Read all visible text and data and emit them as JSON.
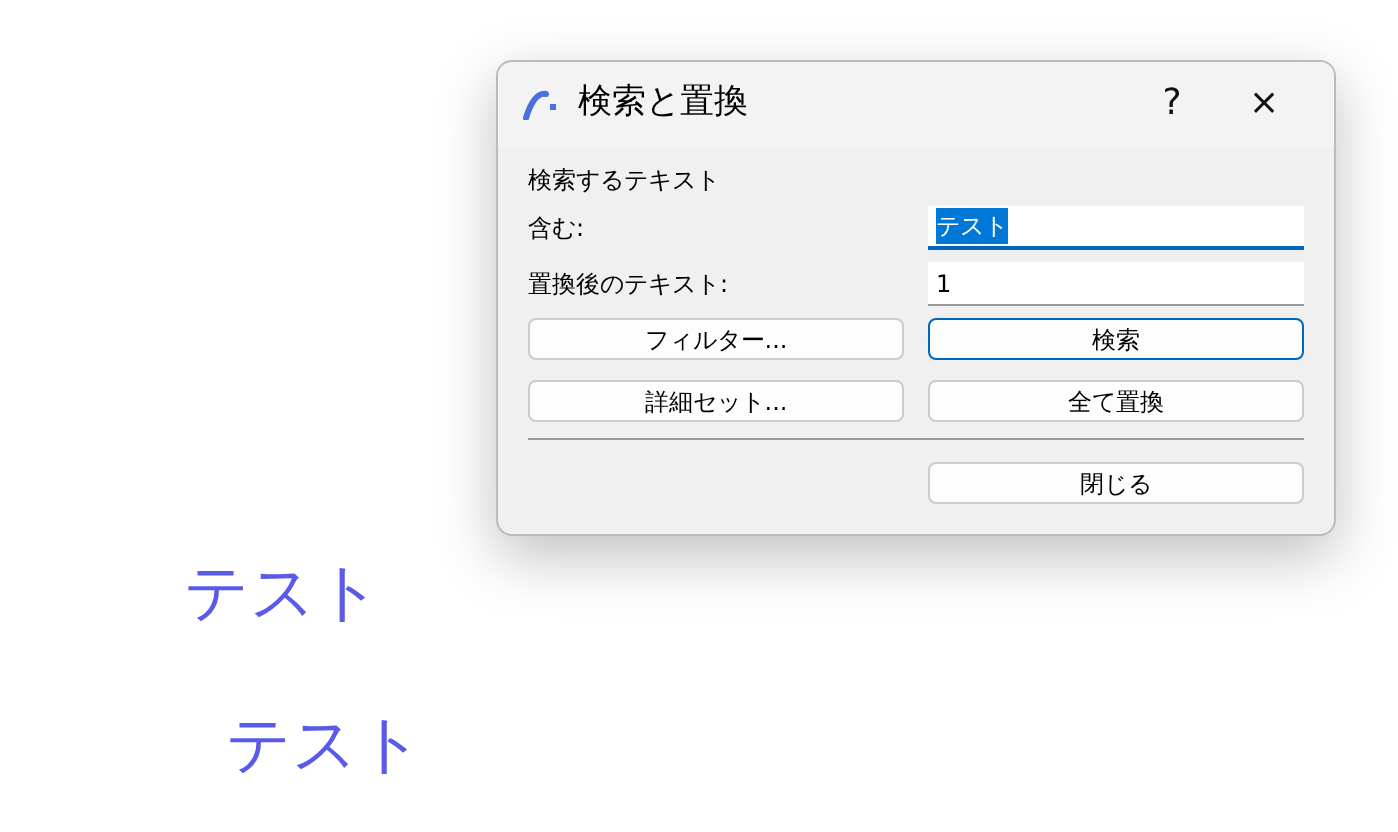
{
  "background_texts": [
    "テスト",
    "テスト"
  ],
  "dialog": {
    "title": "検索と置換",
    "help": "?",
    "close": "×",
    "section_label": "検索するテキスト",
    "fields": [
      {
        "label": "含む:",
        "value": "テスト",
        "focused": true,
        "text_selected": true
      },
      {
        "label": "置換後のテキスト:",
        "value": "1",
        "focused": false,
        "text_selected": false
      }
    ],
    "buttons": [
      {
        "label": "フィルター...",
        "default": false
      },
      {
        "label": "検索",
        "default": true
      },
      {
        "label": "詳細セット...",
        "default": false
      },
      {
        "label": "全て置換",
        "default": false
      }
    ],
    "footer_buttons": [
      {
        "label": "閉じる",
        "default": false
      }
    ]
  }
}
